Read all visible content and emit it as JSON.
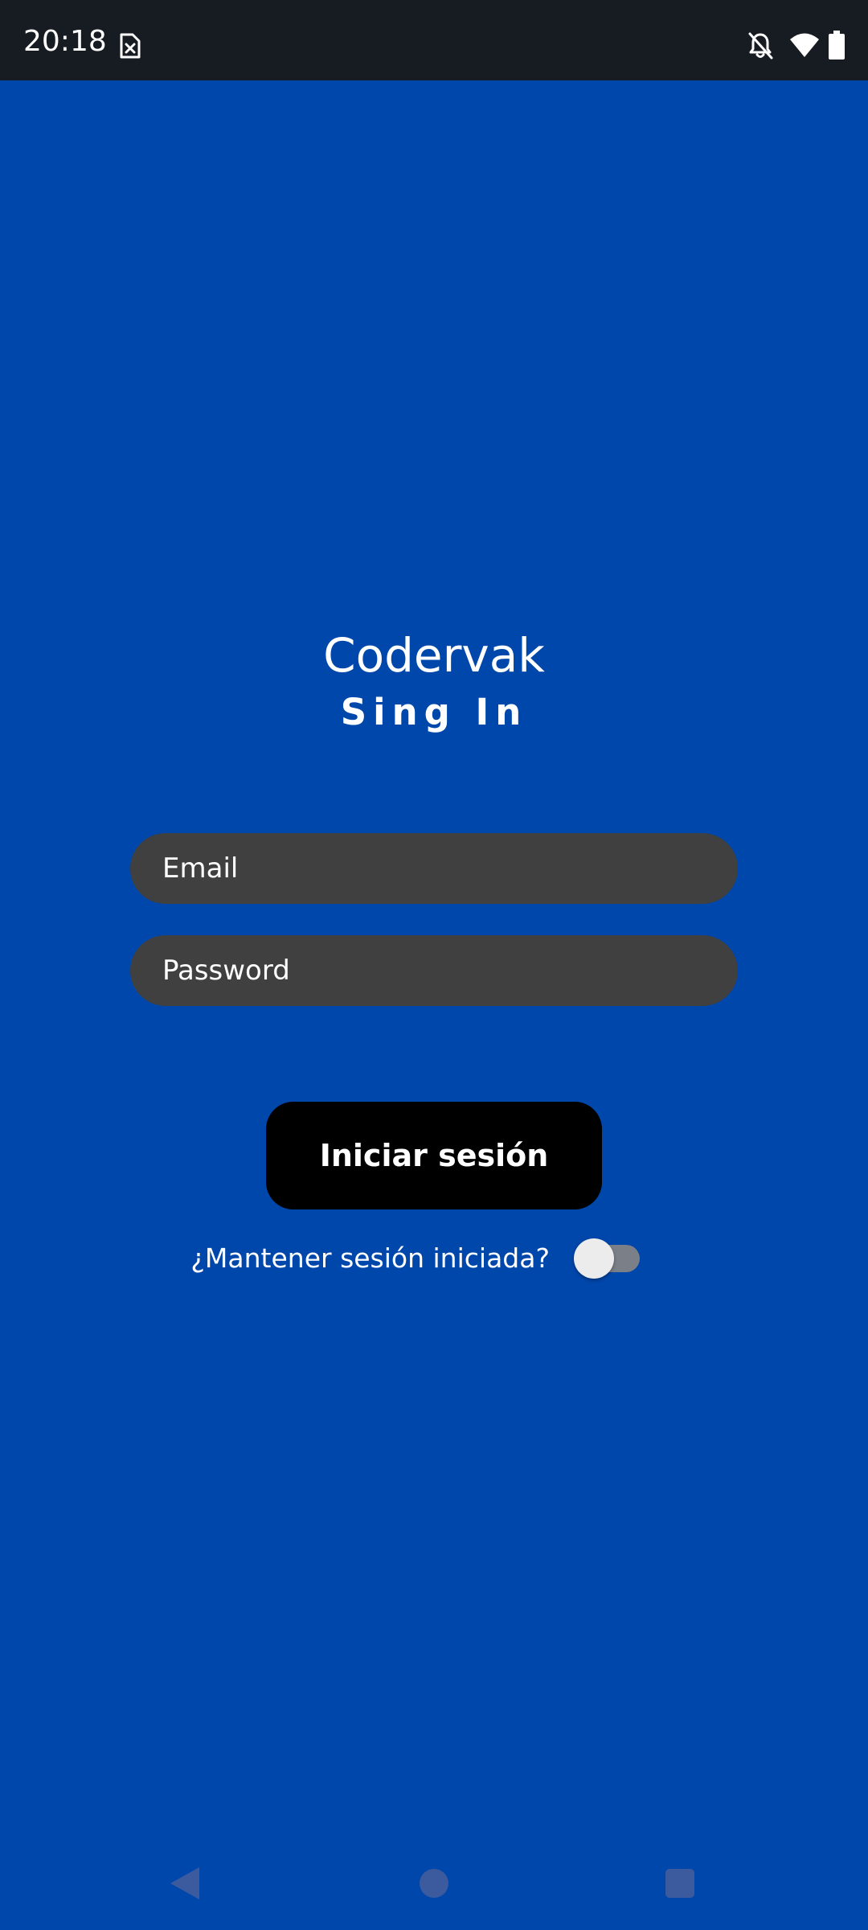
{
  "status_bar": {
    "time": "20:18",
    "icons": [
      "sim-card-missing-icon",
      "notifications-off-icon",
      "wifi-icon",
      "battery-icon"
    ]
  },
  "login": {
    "app_name": "Codervak",
    "subtitle": "Sing In",
    "email_placeholder": "Email",
    "password_placeholder": "Password",
    "submit_label": "Iniciar sesión",
    "remember_label": "¿Mantener sesión iniciada?",
    "remember_enabled": false
  },
  "nav_bar": {
    "icons": [
      "back-icon",
      "home-icon",
      "recents-icon"
    ]
  },
  "colors": {
    "background": "#0047AB",
    "status_bar": "#171B22",
    "input_fill": "#404040",
    "button_fill": "#000000",
    "text": "#FFFFFF",
    "nav_buttons": "#3C5B9F"
  }
}
